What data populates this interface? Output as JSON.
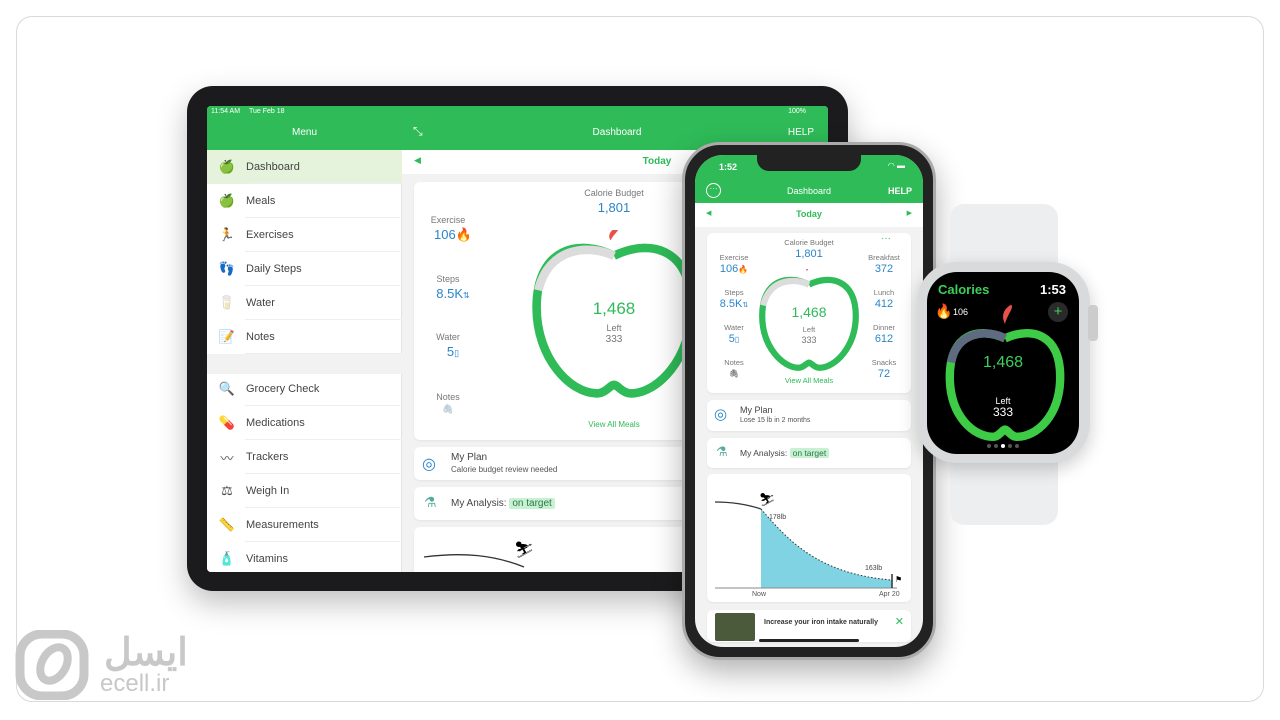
{
  "tablet": {
    "status": {
      "time": "11:54 AM",
      "date": "Tue Feb 18",
      "battery": "100%"
    },
    "menu_title": "Menu",
    "title": "Dashboard",
    "help": "HELP",
    "date_nav": "Today",
    "sidebar": [
      {
        "label": "Dashboard",
        "icon": "app-logo-icon",
        "active": true
      },
      {
        "label": "Meals",
        "icon": "apple-icon"
      },
      {
        "label": "Exercises",
        "icon": "runner-icon"
      },
      {
        "label": "Daily Steps",
        "icon": "footprints-icon"
      },
      {
        "label": "Water",
        "icon": "water-glass-icon"
      },
      {
        "label": "Notes",
        "icon": "notes-icon"
      },
      {
        "label": "Grocery Check",
        "icon": "magnifier-icon"
      },
      {
        "label": "Medications",
        "icon": "pill-icon"
      },
      {
        "label": "Trackers",
        "icon": "tracker-icon"
      },
      {
        "label": "Weigh In",
        "icon": "scale-icon"
      },
      {
        "label": "Measurements",
        "icon": "ruler-icon"
      },
      {
        "label": "Vitamins",
        "icon": "vitamin-icon"
      }
    ],
    "summary": {
      "budget_label": "Calorie Budget",
      "budget": "1,801",
      "exercise_label": "Exercise",
      "exercise": "106",
      "steps_label": "Steps",
      "steps": "8.5K",
      "water_label": "Water",
      "water": "5",
      "notes_label": "Notes",
      "calories": "1,468",
      "left_label": "Left",
      "left": "333",
      "view_all": "View All Meals"
    },
    "plan": {
      "title": "My Plan",
      "subtitle": "Calorie budget review needed"
    },
    "analysis": {
      "label": "My Analysis:",
      "badge": "on target"
    }
  },
  "phone": {
    "status": {
      "time": "1:52"
    },
    "title": "Dashboard",
    "help": "HELP",
    "date_nav": "Today",
    "summary": {
      "budget_label": "Calorie Budget",
      "budget": "1,801",
      "exercise_label": "Exercise",
      "exercise": "106",
      "steps_label": "Steps",
      "steps": "8.5K",
      "water_label": "Water",
      "water": "5",
      "notes_label": "Notes",
      "calories": "1,468",
      "left_label": "Left",
      "left": "333",
      "view_all": "View All Meals",
      "breakfast_label": "Breakfast",
      "breakfast": "372",
      "lunch_label": "Lunch",
      "lunch": "412",
      "dinner_label": "Dinner",
      "dinner": "612",
      "snacks_label": "Snacks",
      "snacks": "72"
    },
    "plan": {
      "title": "My Plan",
      "subtitle": "Lose 15 lb in 2 months"
    },
    "analysis": {
      "label": "My Analysis:",
      "badge": "on target"
    },
    "chart": {
      "start_label": "178lb",
      "end_label": "163lb",
      "x_start": "Now",
      "x_end": "Apr 20"
    },
    "tip": {
      "text": "Increase your iron intake naturally"
    }
  },
  "watch": {
    "title": "Calories",
    "time": "1:53",
    "burned": "106",
    "calories": "1,468",
    "left_label": "Left",
    "left": "333",
    "page_dots": 5,
    "active_dot": 3
  },
  "logo": {
    "text_fa": "ایسل",
    "text_en": "ecell.ir"
  },
  "colors": {
    "brand_green": "#2fbb58",
    "value_blue": "#2a86c8",
    "chart_fill": "#7fd3e3",
    "ring_gray": "#dcdcdc"
  }
}
